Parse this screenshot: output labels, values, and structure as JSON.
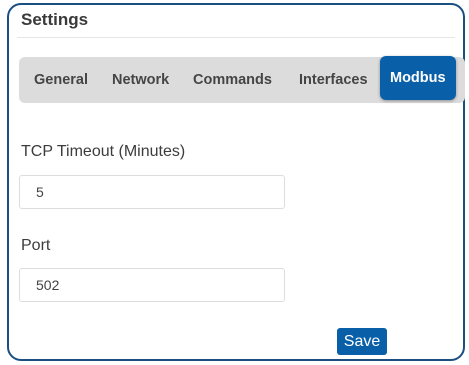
{
  "panel": {
    "title": "Settings"
  },
  "tabs": [
    {
      "label": "General",
      "active": false
    },
    {
      "label": "Network",
      "active": false
    },
    {
      "label": "Commands",
      "active": false
    },
    {
      "label": "Interfaces",
      "active": false
    },
    {
      "label": "Modbus",
      "active": true
    }
  ],
  "form": {
    "tcp_timeout": {
      "label": "TCP Timeout (Minutes)",
      "value": "5"
    },
    "port": {
      "label": "Port",
      "value": "502"
    }
  },
  "actions": {
    "save_label": "Save"
  },
  "colors": {
    "accent": "#0a60a8",
    "border": "#1b4f82",
    "tab_bar": "#dcdcdc"
  }
}
